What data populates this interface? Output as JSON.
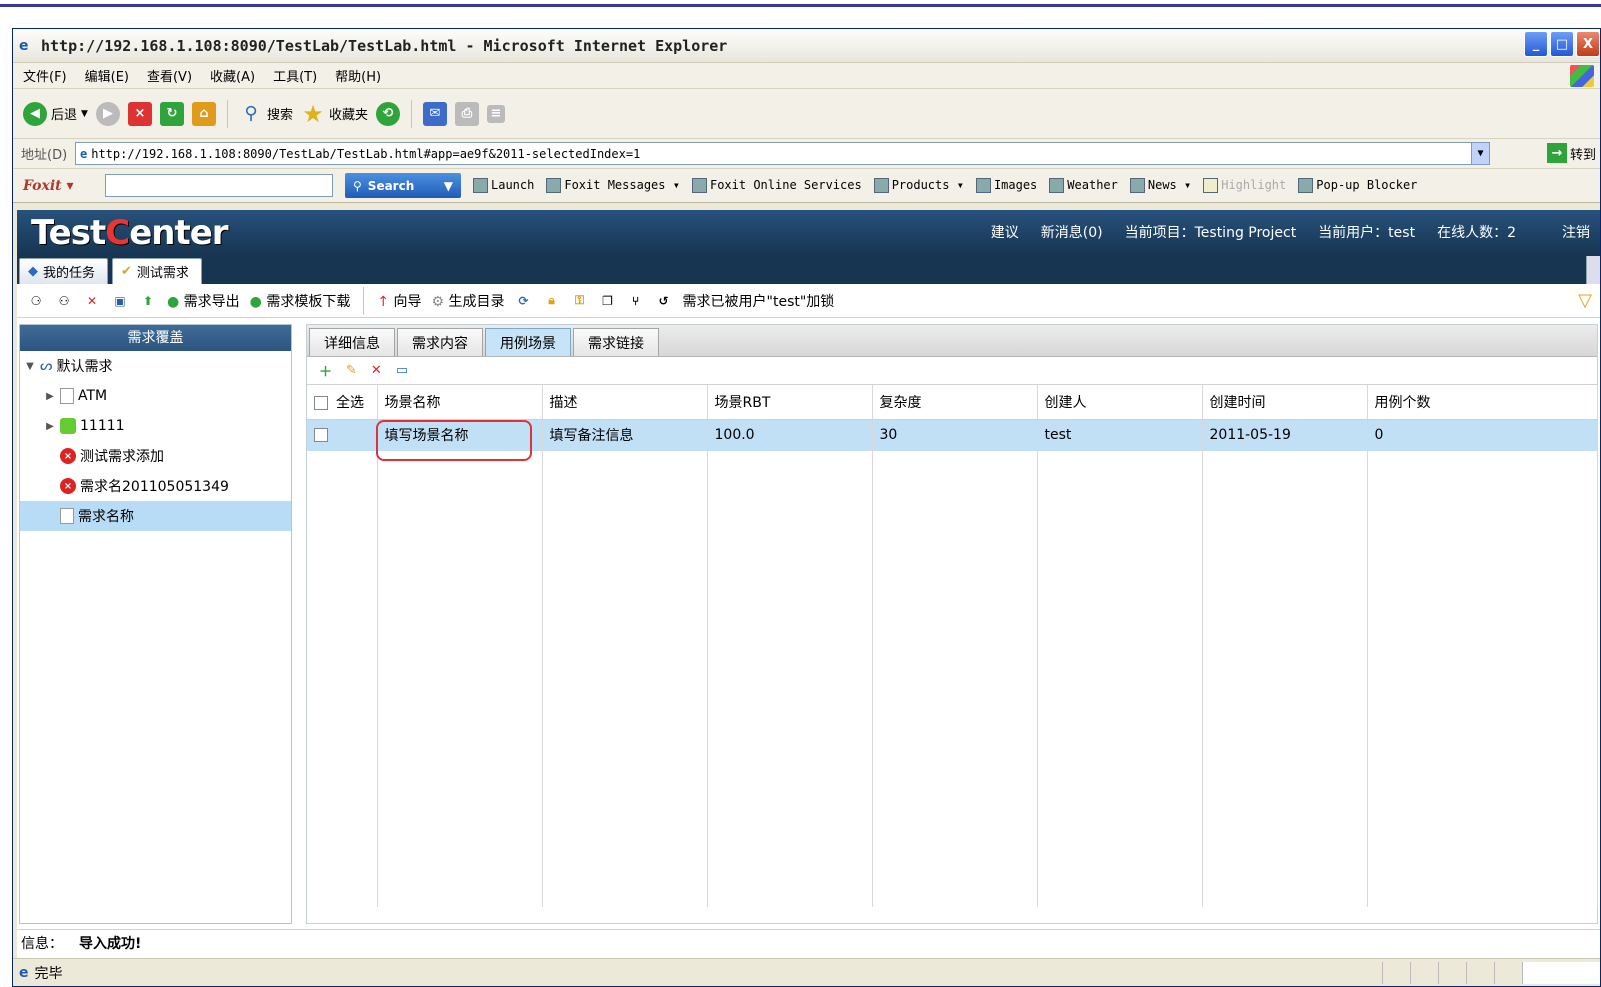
{
  "browser": {
    "title": "http://192.168.1.108:8090/TestLab/TestLab.html - Microsoft Internet Explorer",
    "menu": [
      "文件(F)",
      "编辑(E)",
      "查看(V)",
      "收藏(A)",
      "工具(T)",
      "帮助(H)"
    ],
    "toolbar": {
      "back": "后退",
      "search": "搜索",
      "favorites": "收藏夹"
    },
    "address_label": "地址(D)",
    "address": "http://192.168.1.108:8090/TestLab/TestLab.html#app=ae9f&2011-selectedIndex=1",
    "go_label": "转到",
    "status": "完毕"
  },
  "foxit": {
    "logo": "Foxit",
    "search_button": "Search",
    "items": [
      "Launch",
      "Foxit Messages",
      "Foxit Online Services",
      "Products",
      "Images",
      "Weather",
      "News",
      "Highlight",
      "Pop-up Blocker"
    ]
  },
  "app": {
    "logo_pre": "Test",
    "logo_c": "C",
    "logo_post": "enter",
    "header": [
      "建议",
      "新消息(0)",
      "当前项目：Testing Project",
      "当前用户：test",
      "在线人数：2"
    ],
    "logout": "注销",
    "tabs": [
      "我的任务",
      "测试需求"
    ],
    "toolbar": {
      "export": "需求导出",
      "template": "需求模板下载",
      "wizard": "向导",
      "gen_dir": "生成目录",
      "lock_msg": "需求已被用户\"test\"加锁"
    },
    "left_title": "需求覆盖",
    "tree": [
      "默认需求",
      "ATM",
      "11111",
      "测试需求添加",
      "需求名201105051349",
      "需求名称"
    ],
    "subtabs": [
      "详细信息",
      "需求内容",
      "用例场景",
      "需求链接"
    ],
    "table": {
      "select_all": "全选",
      "headers": [
        "场景名称",
        "描述",
        "场景RBT",
        "复杂度",
        "创建人",
        "创建时间",
        "用例个数"
      ],
      "rows": [
        [
          "填写场景名称",
          "填写备注信息",
          "100.0",
          "30",
          "test",
          "2011-05-19",
          "0"
        ]
      ]
    },
    "info_label": "信息：",
    "info_msg": "导入成功!"
  }
}
